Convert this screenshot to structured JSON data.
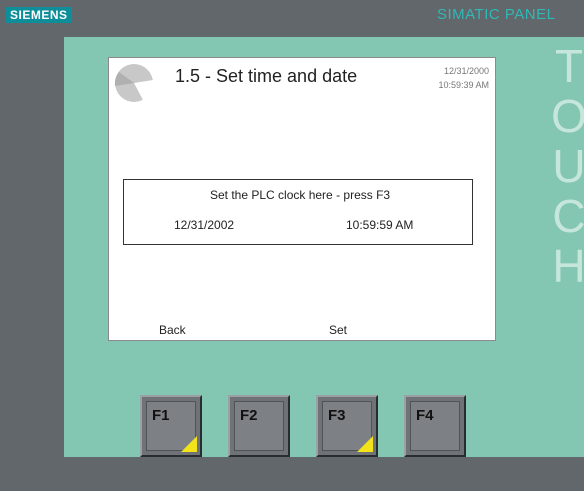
{
  "device": {
    "brand": "SIEMENS",
    "product_line": "SIMATIC PANEL",
    "side_label": "TOUCH"
  },
  "screen": {
    "title": "1.5 - Set time and date",
    "header_date": "12/31/2000",
    "header_time": "10:59:39 AM",
    "panel": {
      "message": "Set the PLC clock here - press F3",
      "date": "12/31/2002",
      "time": "10:59:59 AM"
    },
    "softkeys": {
      "back_label": "Back",
      "set_label": "Set"
    }
  },
  "function_keys": [
    {
      "label": "F1",
      "has_led": true
    },
    {
      "label": "F2",
      "has_led": false
    },
    {
      "label": "F3",
      "has_led": true
    },
    {
      "label": "F4",
      "has_led": false
    }
  ],
  "colors": {
    "brand_bg": "#0d8e99",
    "bezel": "#83c6b1",
    "led": "#f2e21a"
  },
  "icons": {
    "logo": "pie-logo-icon",
    "led": "yellow-triangle-indicator"
  }
}
